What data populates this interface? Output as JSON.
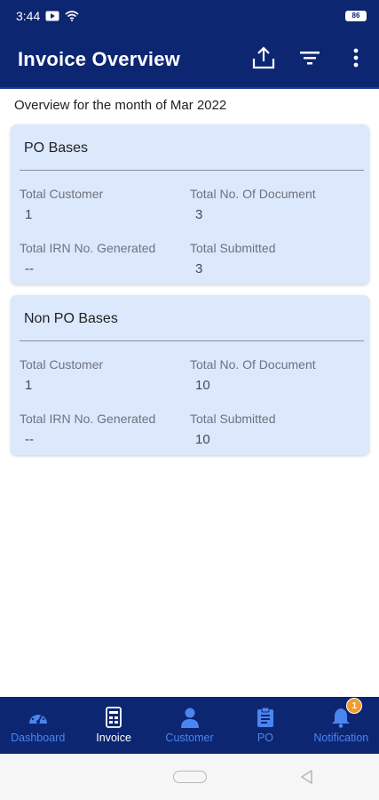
{
  "status_bar": {
    "time": "3:44",
    "battery": "86"
  },
  "header": {
    "title": "Invoice Overview",
    "icons": [
      "upload-icon",
      "filter-icon",
      "more-vert-icon"
    ]
  },
  "subtitle": "Overview for the month of Mar 2022",
  "cards": [
    {
      "title": "PO Bases",
      "stats": [
        {
          "label": "Total Customer",
          "value": "1"
        },
        {
          "label": "Total No. Of Document",
          "value": "3"
        },
        {
          "label": "Total IRN No. Generated",
          "value": "--"
        },
        {
          "label": "Total Submitted",
          "value": "3"
        }
      ]
    },
    {
      "title": "Non PO Bases",
      "stats": [
        {
          "label": "Total Customer",
          "value": "1"
        },
        {
          "label": "Total No. Of Document",
          "value": "10"
        },
        {
          "label": "Total IRN No. Generated",
          "value": "--"
        },
        {
          "label": "Total Submitted",
          "value": "10"
        }
      ]
    }
  ],
  "bottom_nav": {
    "items": [
      {
        "label": "Dashboard",
        "icon": "dashboard-gauge-icon"
      },
      {
        "label": "Invoice",
        "icon": "invoice-icon",
        "active": true
      },
      {
        "label": "Customer",
        "icon": "person-icon"
      },
      {
        "label": "PO",
        "icon": "clipboard-icon"
      },
      {
        "label": "Notification",
        "icon": "bell-icon",
        "badge": "1"
      }
    ]
  },
  "colors": {
    "primary": "#0d2672",
    "card_bg": "#dce8fc",
    "nav_inactive": "#4a86f0",
    "badge": "#f39c2c"
  }
}
